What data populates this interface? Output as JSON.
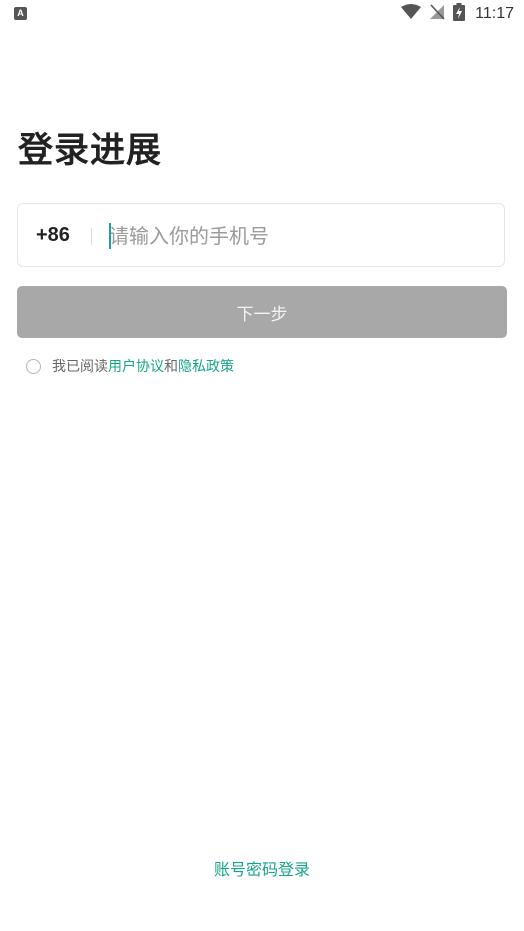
{
  "status_bar": {
    "left_icon": "A",
    "time": "11:17",
    "icons": [
      "wifi-icon",
      "no-signal-icon",
      "battery-charging-icon"
    ]
  },
  "title": "登录进展",
  "phone": {
    "country_code": "+86",
    "placeholder": "请输入你的手机号",
    "value": ""
  },
  "next_button": {
    "label": "下一步",
    "enabled": false
  },
  "agreement": {
    "prefix": "我已阅读",
    "user_agreement": "用户协议",
    "conjunction": "和",
    "privacy_policy": "隐私政策",
    "checked": false
  },
  "account_login_link": "账号密码登录",
  "colors": {
    "accent": "#17a589",
    "button_disabled": "#a8a8a8",
    "caret": "#1aa1a0"
  }
}
